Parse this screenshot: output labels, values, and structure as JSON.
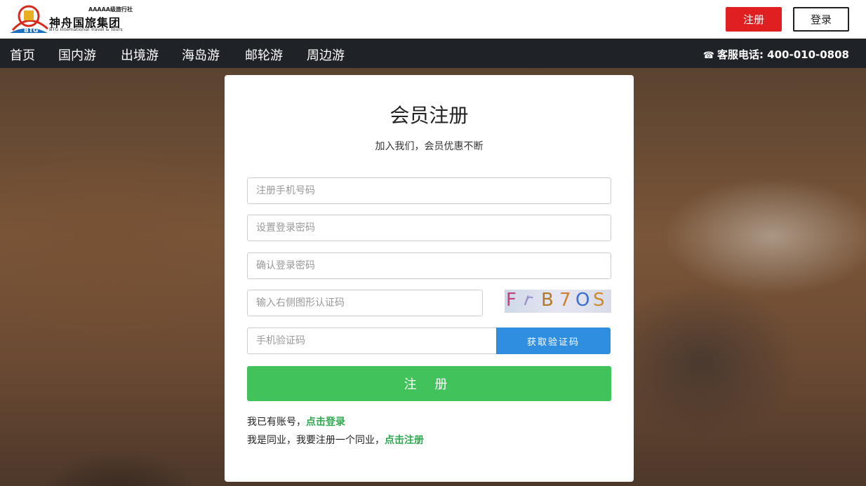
{
  "header": {
    "logo_tag": "AAAAA级旅行社",
    "logo_cn": "神舟国旅集团",
    "logo_en": "BTG International Travel & Tours",
    "logo_badge": "BTG",
    "register_label": "注册",
    "login_label": "登录"
  },
  "nav": {
    "items": [
      "首页",
      "国内游",
      "出境游",
      "海岛游",
      "邮轮游",
      "周边游"
    ],
    "hotline": "客服电话: 400-010-0808"
  },
  "form": {
    "title": "会员注册",
    "subtitle": "加入我们，会员优惠不断",
    "phone_placeholder": "注册手机号码",
    "password_placeholder": "设置登录密码",
    "confirm_placeholder": "确认登录密码",
    "captcha_placeholder": "输入右侧图形认证码",
    "captcha_text": [
      "F",
      "r",
      "B",
      "7",
      "O",
      "S"
    ],
    "sms_placeholder": "手机验证码",
    "sms_button": "获取验证码",
    "submit_label": "注 册",
    "have_account_text": "我已有账号，",
    "have_account_link": "点击登录",
    "agent_text": "我是同业，我要注册一个同业，",
    "agent_link": "点击注册"
  },
  "colors": {
    "register_red": "#e02020",
    "nav_bg": "#1f2328",
    "sms_blue": "#2f8ee0",
    "submit_green": "#42c25a",
    "link_green": "#2fa84f"
  }
}
